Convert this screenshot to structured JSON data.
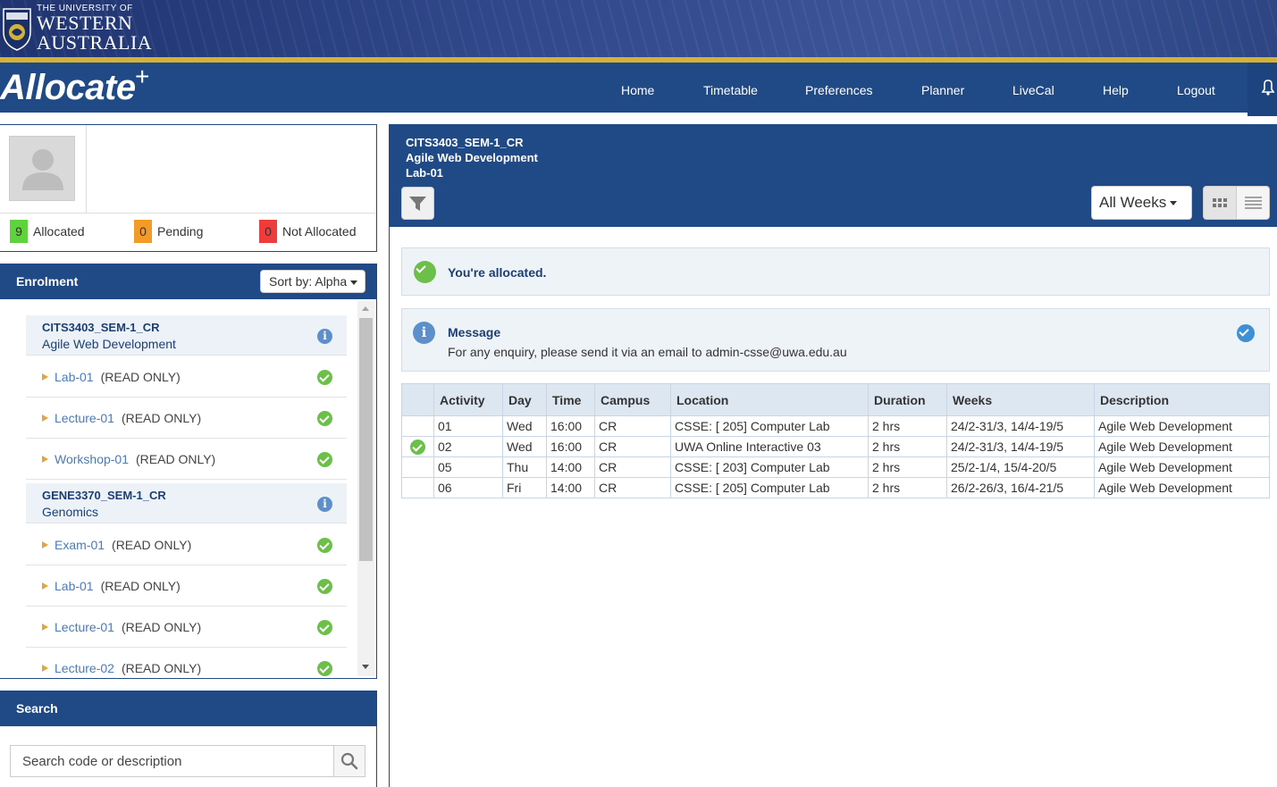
{
  "banner": {
    "uni_line1": "THE UNIVERSITY OF",
    "uni_line2": "WESTERN",
    "uni_line3": "AUSTRALIA"
  },
  "nav": {
    "brand": "Allocate",
    "brand_plus": "+",
    "items": [
      "Home",
      "Timetable",
      "Preferences",
      "Planner",
      "LiveCal",
      "Help",
      "Logout"
    ]
  },
  "status": {
    "allocated": {
      "count": "9",
      "label": "Allocated",
      "color": "#5fd33c"
    },
    "pending": {
      "count": "0",
      "label": "Pending",
      "color": "#f29b26"
    },
    "not_allocated": {
      "count": "0",
      "label": "Not Allocated",
      "color": "#ee3b3b"
    }
  },
  "enrolment": {
    "title": "Enrolment",
    "sort_label": "Sort by: Alpha",
    "courses": [
      {
        "code": "CITS3403_SEM-1_CR",
        "name": "Agile Web Development",
        "activities": [
          {
            "label": "Lab-01",
            "note": "(READ ONLY)"
          },
          {
            "label": "Lecture-01",
            "note": "(READ ONLY)"
          },
          {
            "label": "Workshop-01",
            "note": "(READ ONLY)"
          }
        ]
      },
      {
        "code": "GENE3370_SEM-1_CR",
        "name": "Genomics",
        "activities": [
          {
            "label": "Exam-01",
            "note": "(READ ONLY)"
          },
          {
            "label": "Lab-01",
            "note": "(READ ONLY)"
          },
          {
            "label": "Lecture-01",
            "note": "(READ ONLY)"
          },
          {
            "label": "Lecture-02",
            "note": "(READ ONLY)"
          }
        ]
      }
    ]
  },
  "search": {
    "title": "Search",
    "placeholder": "Search code or description"
  },
  "detail": {
    "code": "CITS3403_SEM-1_CR",
    "name": "Agile Web Development",
    "activity": "Lab-01",
    "weeks_label": "All Weeks",
    "allocated_msg": "You're allocated.",
    "message_title": "Message",
    "message_text": "For any enquiry, please send it via an email to admin-csse@uwa.edu.au",
    "table": {
      "headers": [
        "Activity",
        "Day",
        "Time",
        "Campus",
        "Location",
        "Duration",
        "Weeks",
        "Description"
      ],
      "rows": [
        {
          "selected": false,
          "cells": [
            "01",
            "Wed",
            "16:00",
            "CR",
            "CSSE: [ 205] Computer Lab",
            "2 hrs",
            "24/2-31/3, 14/4-19/5",
            "Agile Web Development"
          ]
        },
        {
          "selected": true,
          "cells": [
            "02",
            "Wed",
            "16:00",
            "CR",
            "UWA Online Interactive 03",
            "2 hrs",
            "24/2-31/3, 14/4-19/5",
            "Agile Web Development"
          ]
        },
        {
          "selected": false,
          "cells": [
            "05",
            "Thu",
            "14:00",
            "CR",
            "CSSE: [ 203] Computer Lab",
            "2 hrs",
            "25/2-1/4, 15/4-20/5",
            "Agile Web Development"
          ]
        },
        {
          "selected": false,
          "cells": [
            "06",
            "Fri",
            "14:00",
            "CR",
            "CSSE: [ 205] Computer Lab",
            "2 hrs",
            "26/2-26/3, 16/4-21/5",
            "Agile Web Development"
          ]
        }
      ]
    }
  }
}
